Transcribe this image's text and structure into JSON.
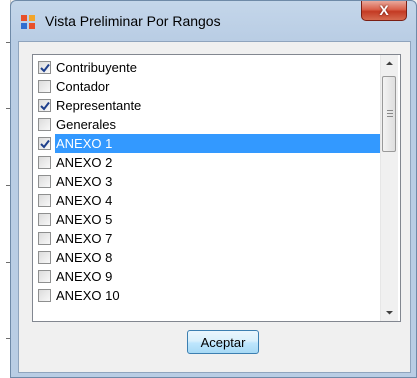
{
  "window": {
    "title": "Vista Preliminar Por Rangos",
    "close_label": "X"
  },
  "list": {
    "items": [
      {
        "label": "Contribuyente",
        "checked": true,
        "selected": false
      },
      {
        "label": "Contador",
        "checked": false,
        "selected": false
      },
      {
        "label": "Representante",
        "checked": true,
        "selected": false
      },
      {
        "label": "Generales",
        "checked": false,
        "selected": false
      },
      {
        "label": "ANEXO 1",
        "checked": true,
        "selected": true
      },
      {
        "label": "ANEXO 2",
        "checked": false,
        "selected": false
      },
      {
        "label": "ANEXO 3",
        "checked": false,
        "selected": false
      },
      {
        "label": "ANEXO 4",
        "checked": false,
        "selected": false
      },
      {
        "label": "ANEXO 5",
        "checked": false,
        "selected": false
      },
      {
        "label": "ANEXO 7",
        "checked": false,
        "selected": false
      },
      {
        "label": "ANEXO 8",
        "checked": false,
        "selected": false
      },
      {
        "label": "ANEXO 9",
        "checked": false,
        "selected": false
      },
      {
        "label": "ANEXO 10",
        "checked": false,
        "selected": false
      }
    ]
  },
  "buttons": {
    "accept_label": "Aceptar"
  },
  "colors": {
    "selection": "#3399ff",
    "check": "#1e3f8c"
  }
}
